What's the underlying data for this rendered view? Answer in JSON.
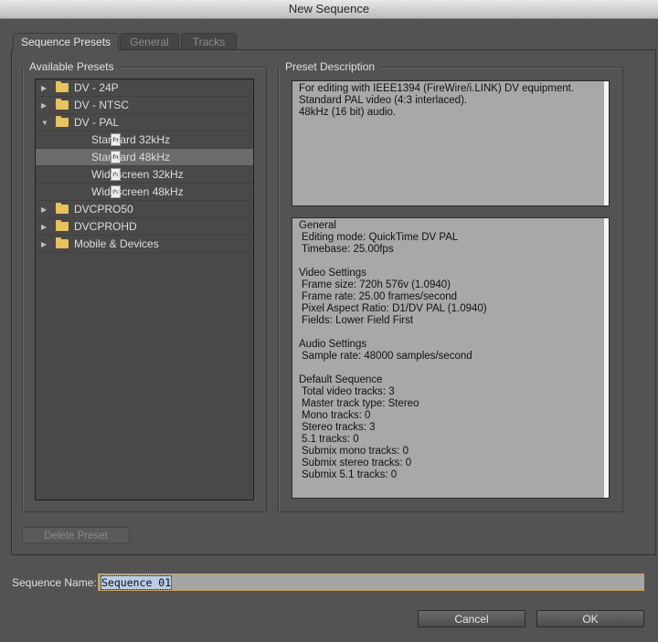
{
  "window": {
    "title": "New Sequence"
  },
  "tabs": [
    {
      "label": "Sequence Presets",
      "active": true
    },
    {
      "label": "General",
      "active": false
    },
    {
      "label": "Tracks",
      "active": false
    }
  ],
  "presets": {
    "label": "Available Presets",
    "items": [
      {
        "label": "DV - 24P"
      },
      {
        "label": "DV - NTSC"
      },
      {
        "label": "DV - PAL"
      },
      {
        "label": "Standard 32kHz"
      },
      {
        "label": "Standard 48kHz"
      },
      {
        "label": "Widescreen 32kHz"
      },
      {
        "label": "Widescreen 48kHz"
      },
      {
        "label": "DVCPRO50"
      },
      {
        "label": "DVCPROHD"
      },
      {
        "label": "Mobile & Devices"
      }
    ],
    "delete_button": "Delete Preset"
  },
  "description": {
    "label": "Preset Description",
    "text_lines": [
      "For editing with IEEE1394 (FireWire/i.LINK) DV equipment.",
      "Standard PAL video (4:3 interlaced).",
      "48kHz (16 bit) audio."
    ],
    "details": {
      "general_title": "General",
      "editing_mode": "Editing mode: QuickTime DV PAL",
      "timebase": "Timebase: 25.00fps",
      "video_title": "Video Settings",
      "frame_size": "Frame size: 720h 576v (1.0940)",
      "frame_rate": "Frame rate: 25.00 frames/second",
      "pixel_aspect": "Pixel Aspect Ratio: D1/DV PAL (1.0940)",
      "fields": "Fields: Lower Field First",
      "audio_title": "Audio Settings",
      "sample_rate": "Sample rate: 48000 samples/second",
      "default_title": "Default Sequence",
      "total_video": "Total video tracks: 3",
      "master_type": "Master track type: Stereo",
      "mono": "Mono tracks: 0",
      "stereo": "Stereo tracks: 3",
      "five_one": "5.1 tracks: 0",
      "submix_mono": "Submix mono tracks: 0",
      "submix_stereo": "Submix stereo tracks: 0",
      "submix_51": "Submix 5.1 tracks: 0"
    }
  },
  "sequence_name": {
    "label": "Sequence Name:",
    "value": "Sequence 01"
  },
  "buttons": {
    "cancel": "Cancel",
    "ok": "OK"
  },
  "icons": {
    "folder": "folder-icon",
    "preset_file": "premiere-preset-file-icon",
    "expand": "triangle-icon"
  }
}
